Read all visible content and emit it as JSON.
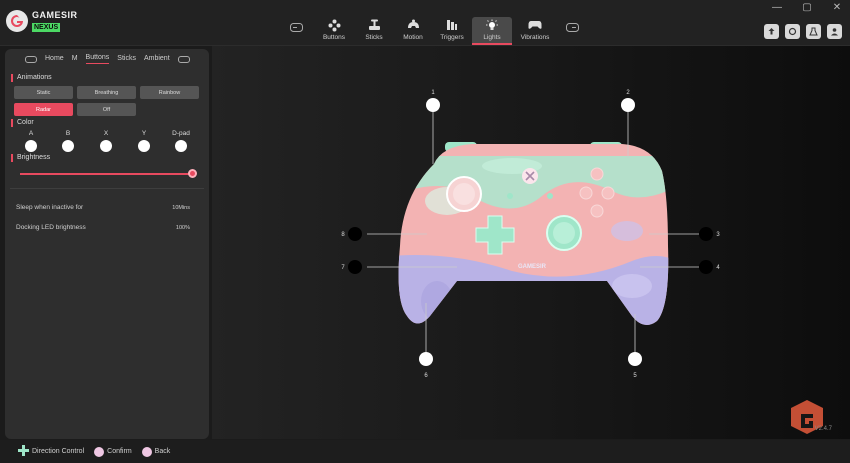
{
  "window": {
    "controls": [
      "—",
      "▢",
      "✕"
    ]
  },
  "brand": {
    "name": "GAMESIR",
    "product": "NEXUS"
  },
  "nav": {
    "items": [
      {
        "label": "Buttons",
        "icon": "dpad-icon"
      },
      {
        "label": "Sticks",
        "icon": "sticks-icon"
      },
      {
        "label": "Motion",
        "icon": "motion-icon"
      },
      {
        "label": "Triggers",
        "icon": "triggers-icon"
      },
      {
        "label": "Lights",
        "icon": "light-bulb-icon"
      },
      {
        "label": "Vibrations",
        "icon": "gamepad-icon"
      }
    ],
    "active": "Lights"
  },
  "tools": [
    "upload-icon",
    "refresh-icon",
    "flask-icon",
    "user-icon"
  ],
  "panel": {
    "subtabs": [
      "Home",
      "M",
      "Buttons",
      "Sticks",
      "Ambient"
    ],
    "active_subtab": "Buttons",
    "animations": {
      "title": "Animations",
      "options": [
        "Static",
        "Breathing",
        "Rainbow",
        "Radar",
        "Off"
      ],
      "selected": "Radar"
    },
    "color": {
      "title": "Color",
      "items": [
        "A",
        "B",
        "X",
        "Y",
        "D-pad"
      ]
    },
    "brightness": {
      "title": "Brightness",
      "level": 1.0
    },
    "settings": [
      {
        "label": "Sleep when inactive for",
        "value": "10Mins"
      },
      {
        "label": "Docking LED brightness",
        "value": "100%"
      }
    ]
  },
  "controller": {
    "light_zones": [
      "1",
      "2",
      "3",
      "4",
      "5",
      "6",
      "7",
      "8"
    ],
    "brand_text": "GAMESIR"
  },
  "footer": {
    "hints": [
      {
        "label": "Direction Control",
        "icon": "dpad-icon"
      },
      {
        "label": "Confirm",
        "icon": "circle-button-icon"
      },
      {
        "label": "Back",
        "icon": "circle-button-icon"
      }
    ]
  },
  "version": "V2.4.7",
  "colors": {
    "accent": "#e84a5f",
    "mint": "#9fe6c9",
    "pink": "#f3b3b3",
    "lavender": "#b9b2e6"
  }
}
